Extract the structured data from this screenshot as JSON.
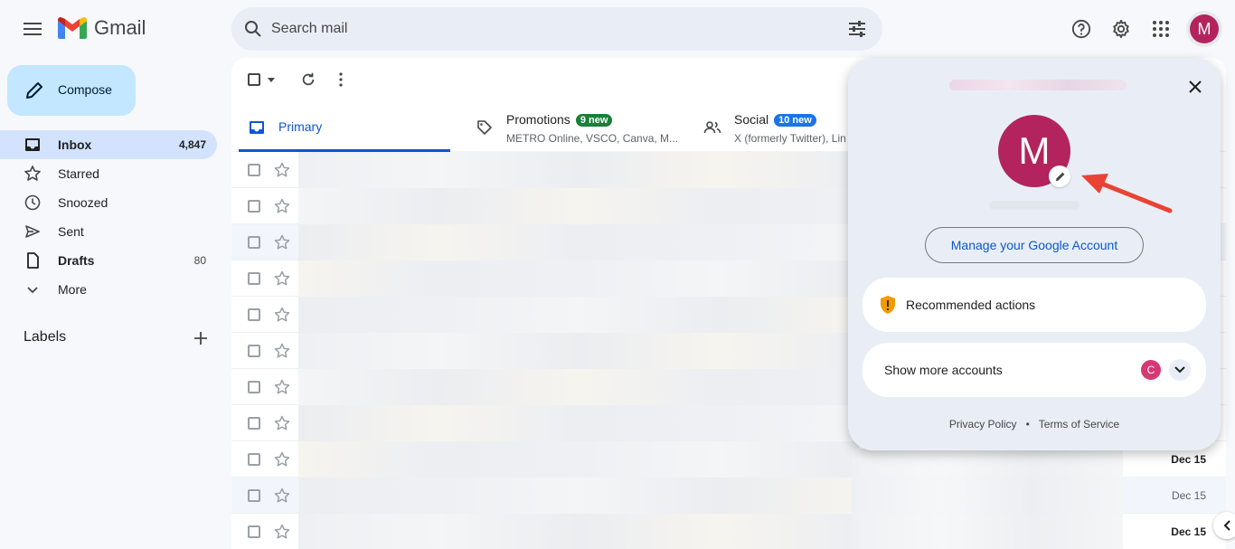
{
  "header": {
    "app_name": "Gmail",
    "search_placeholder": "Search mail",
    "avatar_initial": "M"
  },
  "sidebar": {
    "compose_label": "Compose",
    "items": [
      {
        "label": "Inbox",
        "count": "4,847",
        "icon": "inbox-icon"
      },
      {
        "label": "Starred",
        "count": "",
        "icon": "star-icon"
      },
      {
        "label": "Snoozed",
        "count": "",
        "icon": "clock-icon"
      },
      {
        "label": "Sent",
        "count": "",
        "icon": "send-icon"
      },
      {
        "label": "Drafts",
        "count": "80",
        "icon": "draft-icon"
      },
      {
        "label": "More",
        "count": "",
        "icon": "chevron-down-icon"
      }
    ],
    "labels_heading": "Labels"
  },
  "tabs": [
    {
      "title": "Primary",
      "badge": "",
      "subtitle": ""
    },
    {
      "title": "Promotions",
      "badge": "9 new",
      "subtitle": "METRO Online, VSCO, Canva, M..."
    },
    {
      "title": "Social",
      "badge": "10 new",
      "subtitle": "X (formerly Twitter), Lin"
    }
  ],
  "rows": [
    {
      "date": ""
    },
    {
      "date": ""
    },
    {
      "date": ""
    },
    {
      "date": ""
    },
    {
      "date": ""
    },
    {
      "date": ""
    },
    {
      "date": ""
    },
    {
      "date": ""
    },
    {
      "date": "Dec 15",
      "unread": true
    },
    {
      "date": "Dec 15",
      "unread": false
    },
    {
      "date": "Dec 15",
      "unread": true
    }
  ],
  "account_popup": {
    "avatar_initial": "M",
    "manage_label": "Manage your Google Account",
    "recommended_label": "Recommended actions",
    "show_more_label": "Show more accounts",
    "other_account_initial": "C",
    "privacy_label": "Privacy Policy",
    "separator": "•",
    "terms_label": "Terms of Service"
  },
  "colors": {
    "accent": "#0b57d0",
    "avatar": "#b3245e",
    "promotions_badge": "#188038",
    "social_badge": "#1a73e8",
    "arrow": "#ea4335"
  }
}
